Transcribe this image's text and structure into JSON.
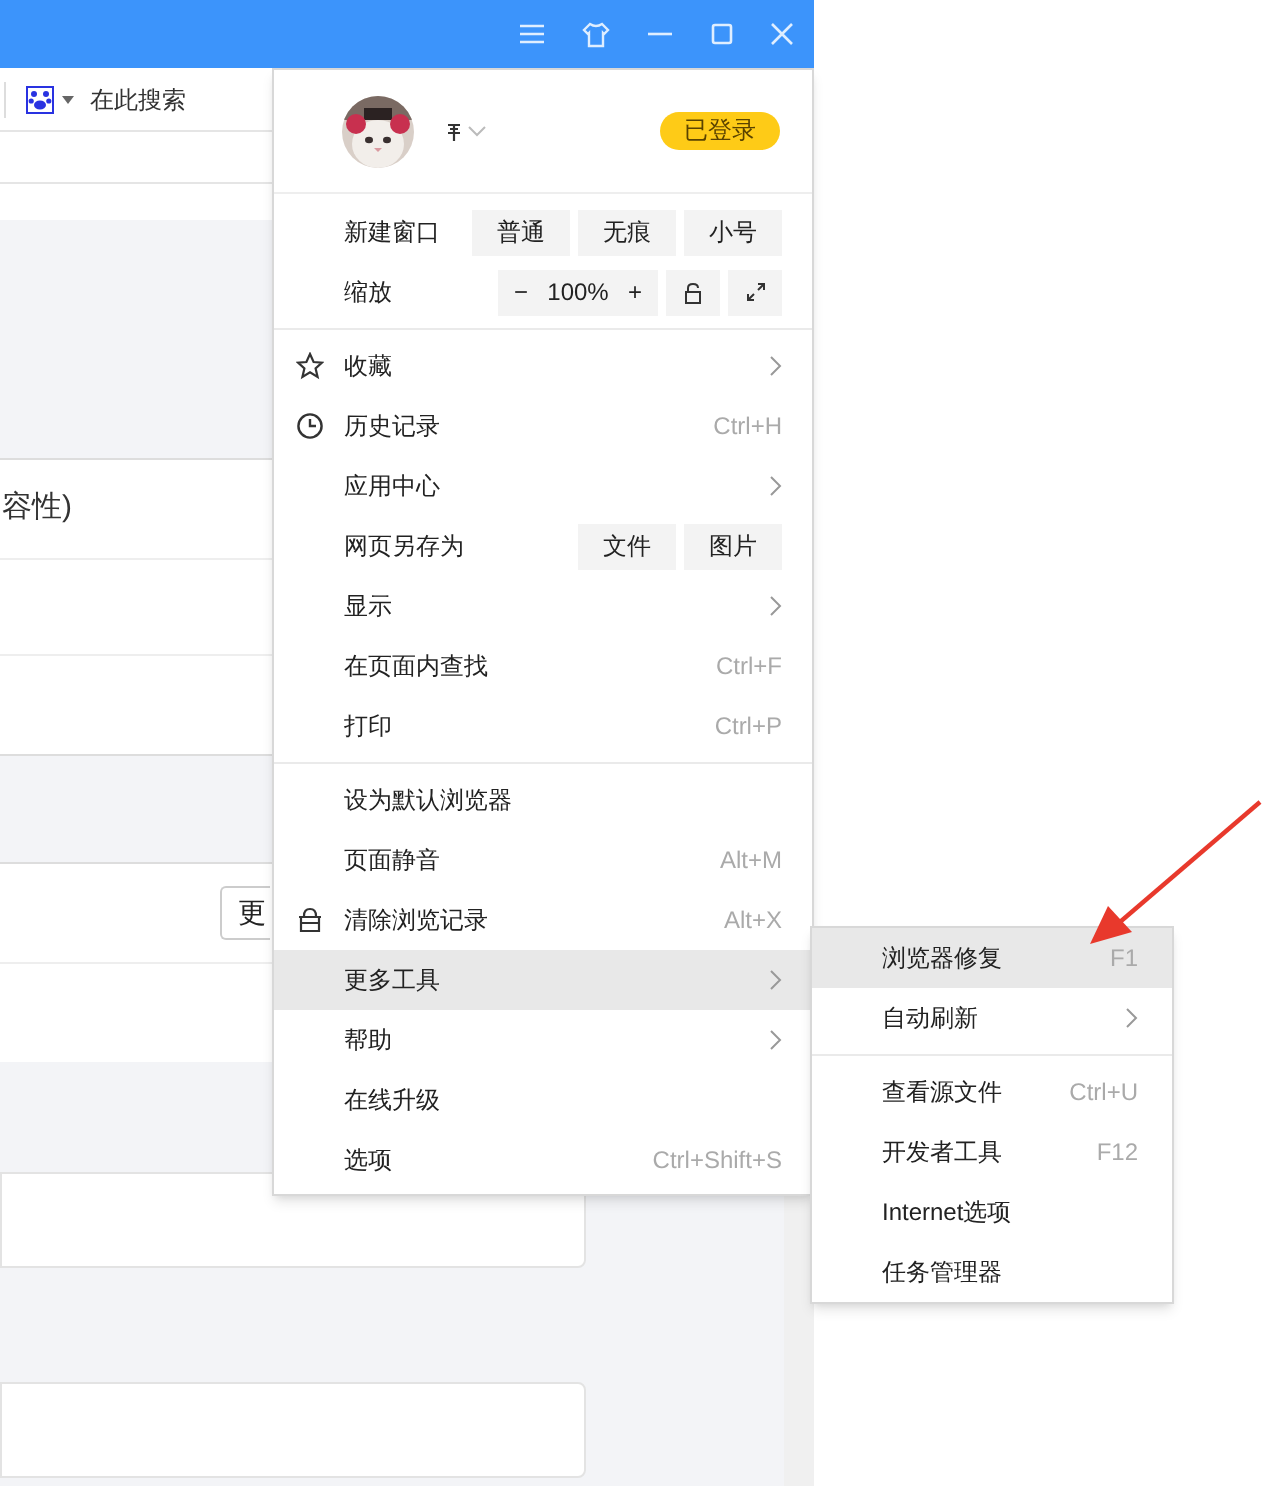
{
  "page": {
    "search_placeholder": "在此搜索",
    "clipped_text": "容性)",
    "clipped_button": "更"
  },
  "profile": {
    "kind": "picture",
    "badge": "已登录"
  },
  "main_menu": [
    {
      "kind": "buttons",
      "label": "新建窗口",
      "buttons": [
        "普通",
        "无痕",
        "小号"
      ]
    },
    {
      "kind": "zoom",
      "label": "缩放",
      "minus": "−",
      "value": "100%",
      "plus": "+"
    },
    {
      "kind": "divider"
    },
    {
      "kind": "submenu",
      "label": "收藏",
      "selected": false
    },
    {
      "kind": "shortcut",
      "label": "历史记录",
      "shortcut": "Ctrl+H",
      "selected": false
    },
    {
      "kind": "submenu",
      "label": "应用中心",
      "selected": false
    },
    {
      "kind": "buttons",
      "label": "网页另存为",
      "buttons": [
        "文件",
        "图片"
      ]
    },
    {
      "kind": "submenu",
      "label": "显示",
      "selected": false
    },
    {
      "kind": "shortcut",
      "label": "在页面内查找",
      "shortcut": "Ctrl+F",
      "selected": false
    },
    {
      "kind": "shortcut",
      "label": "打印",
      "shortcut": "Ctrl+P",
      "selected": false
    },
    {
      "kind": "divider"
    },
    {
      "kind": "plain",
      "label": "设为默认浏览器",
      "selected": false
    },
    {
      "kind": "shortcut",
      "label": "页面静音",
      "shortcut": "Alt+M",
      "selected": false
    },
    {
      "kind": "shortcut",
      "label": "清除浏览记录",
      "shortcut": "Alt+X",
      "selected": false
    },
    {
      "kind": "submenu",
      "label": "更多工具",
      "selected": true
    },
    {
      "kind": "submenu",
      "label": "帮助",
      "selected": false
    },
    {
      "kind": "plain",
      "label": "在线升级",
      "selected": false
    },
    {
      "kind": "shortcut",
      "label": "选项",
      "shortcut": "Ctrl+Shift+S",
      "selected": false
    }
  ],
  "submenu": [
    {
      "kind": "shortcut",
      "label": "浏览器修复",
      "shortcut": "F1",
      "selected": true
    },
    {
      "kind": "submenu",
      "label": "自动刷新",
      "selected": false
    },
    {
      "kind": "divider"
    },
    {
      "kind": "shortcut",
      "label": "查看源文件",
      "shortcut": "Ctrl+U",
      "selected": false
    },
    {
      "kind": "shortcut",
      "label": "开发者工具",
      "shortcut": "F12",
      "selected": false
    },
    {
      "kind": "plain",
      "label": "Internet选项",
      "selected": false
    },
    {
      "kind": "plain",
      "label": "任务管理器",
      "selected": false
    }
  ]
}
